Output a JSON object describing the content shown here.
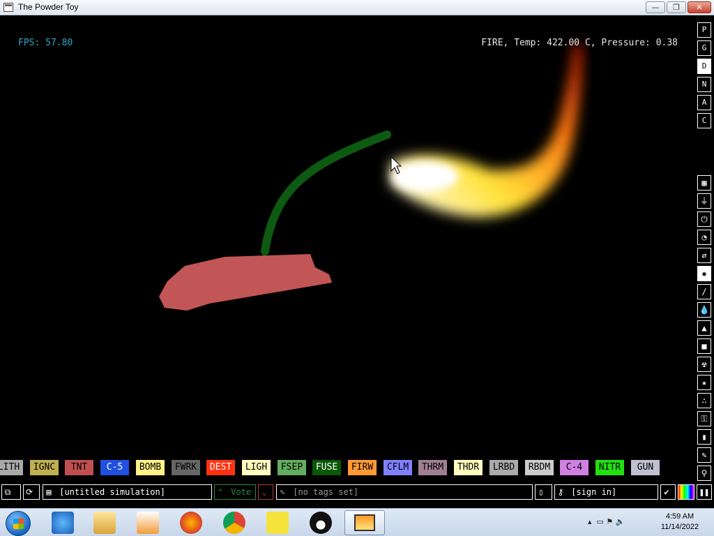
{
  "window": {
    "title": "The Powder Toy",
    "min": "—",
    "max": "❐",
    "close": "✕"
  },
  "hud": {
    "fps": "FPS: 57.80",
    "info": "FIRE, Temp: 422.00 C, Pressure: 0.38"
  },
  "menu_top": [
    "P",
    "G",
    "D",
    "N",
    "A",
    "C"
  ],
  "menu_categories": [
    {
      "name": "walls",
      "glyph": "▦"
    },
    {
      "name": "electronics",
      "glyph": "⏚"
    },
    {
      "name": "powered",
      "glyph": "⏻"
    },
    {
      "name": "sensors",
      "glyph": "◔"
    },
    {
      "name": "force",
      "glyph": "⇄"
    },
    {
      "name": "explosives",
      "glyph": "✹"
    },
    {
      "name": "gases",
      "glyph": "∕"
    },
    {
      "name": "liquids",
      "glyph": "💧"
    },
    {
      "name": "powders",
      "glyph": "▲"
    },
    {
      "name": "solids",
      "glyph": "■"
    },
    {
      "name": "radioactive",
      "glyph": "☢"
    },
    {
      "name": "special",
      "glyph": "★"
    },
    {
      "name": "particles",
      "glyph": "∴"
    },
    {
      "name": "life",
      "glyph": "⚿"
    },
    {
      "name": "tools",
      "glyph": "▮"
    },
    {
      "name": "decoration",
      "glyph": "✎"
    },
    {
      "name": "search",
      "glyph": "⚲"
    }
  ],
  "elements": [
    {
      "label": "LITH",
      "bg": "#a9a9a9",
      "fg": "#000000"
    },
    {
      "label": "IGNC",
      "bg": "#c0b050",
      "fg": "#000000"
    },
    {
      "label": "TNT",
      "bg": "#c05050",
      "fg": "#000000"
    },
    {
      "label": "C-5",
      "bg": "#2050e0",
      "fg": "#ffffff"
    },
    {
      "label": "BOMB",
      "bg": "#fff288",
      "fg": "#000000"
    },
    {
      "label": "FWRK",
      "bg": "#666666",
      "fg": "#000000"
    },
    {
      "label": "DEST",
      "bg": "#ff3311",
      "fg": "#ffffff"
    },
    {
      "label": "LIGH",
      "bg": "#fffbbe",
      "fg": "#000000"
    },
    {
      "label": "FSEP",
      "bg": "#63ad5f",
      "fg": "#000000"
    },
    {
      "label": "FUSE",
      "bg": "#0a5706",
      "fg": "#ffffff"
    },
    {
      "label": "FIRW",
      "bg": "#ff9933",
      "fg": "#000000"
    },
    {
      "label": "CFLM",
      "bg": "#8080ff",
      "fg": "#000000"
    },
    {
      "label": "THRM",
      "bg": "#a08090",
      "fg": "#000000"
    },
    {
      "label": "THDR",
      "bg": "#fffbbe",
      "fg": "#000000"
    },
    {
      "label": "LRBD",
      "bg": "#aaaaaa",
      "fg": "#000000"
    },
    {
      "label": "RBDM",
      "bg": "#cccccc",
      "fg": "#000000"
    },
    {
      "label": "C-4",
      "bg": "#d080e0",
      "fg": "#000000"
    },
    {
      "label": "NITR",
      "bg": "#20e010",
      "fg": "#000000"
    },
    {
      "label": "GUN",
      "bg": "#c0c0d0",
      "fg": "#000000"
    }
  ],
  "bottombar": {
    "sim_name": "[untitled simulation]",
    "vote": "Vote",
    "tags": "[no tags set]",
    "sign_in": "[sign in]"
  },
  "taskbar": {
    "time": "4:59 AM",
    "date": "11/14/2022",
    "apps": [
      "internet-explorer-icon",
      "file-explorer-icon",
      "media-player-icon",
      "firefox-icon",
      "chrome-icon",
      "spongebob-game-icon",
      "pingu-game-icon",
      "powder-toy-icon"
    ]
  }
}
